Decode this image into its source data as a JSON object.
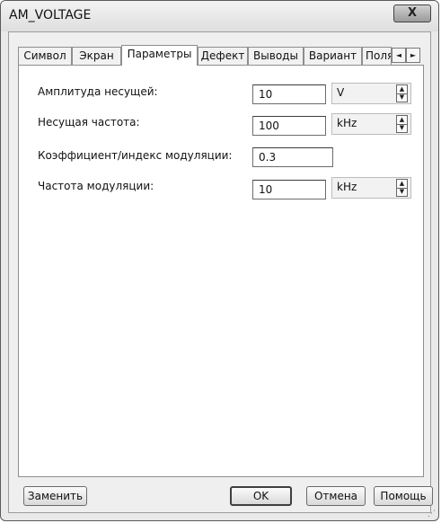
{
  "window": {
    "title": "AM_VOLTAGE",
    "close_glyph": "X"
  },
  "tabs": [
    {
      "label": "Символ",
      "active": false
    },
    {
      "label": "Экран",
      "active": false
    },
    {
      "label": "Параметры",
      "active": true
    },
    {
      "label": "Дефект",
      "active": false
    },
    {
      "label": "Выводы",
      "active": false
    },
    {
      "label": "Вариант",
      "active": false
    },
    {
      "label": "Поля",
      "active": false
    }
  ],
  "tab_scroll": {
    "left": "◄",
    "right": "►"
  },
  "params": [
    {
      "label": "Амплитуда несущей:",
      "value": "10",
      "unit": "V"
    },
    {
      "label": "Несущая частота:",
      "value": "100",
      "unit": "kHz"
    },
    {
      "label": "Коэффициент/индекс модуляции:",
      "value": "0.3"
    },
    {
      "label": "Частота модуляции:",
      "value": "10",
      "unit": "kHz"
    }
  ],
  "buttons": {
    "replace": "Заменить",
    "ok": "OK",
    "cancel": "Отмена",
    "help": "Помощь"
  },
  "icons": {
    "spin_up": "▲",
    "spin_down": "▼",
    "grip": "⋰"
  }
}
